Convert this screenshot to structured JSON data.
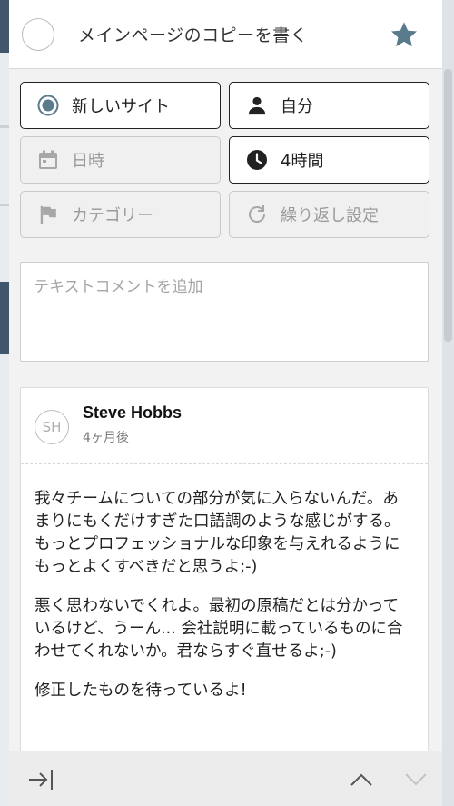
{
  "task": {
    "title": "メインページのコピーを書く",
    "starred": true
  },
  "options": {
    "site": "新しいサイト",
    "assignee": "自分",
    "datetime": "日時",
    "duration": "4時間",
    "category": "カテゴリー",
    "repeat": "繰り返し設定"
  },
  "comment_input": {
    "placeholder": "テキストコメントを追加"
  },
  "comment": {
    "avatar_initials": "SH",
    "author": "Steve Hobbs",
    "time": "4ヶ月後",
    "paragraphs": [
      "我々チームについての部分が気に入らないんだ。あまりにもくだけすぎた口語調のような感じがする。もっとプロフェッショナルな印象を与えれるようにもっとよくすべきだと思うよ;-)",
      "悪く思わないでくれよ。最初の原稿だとは分かっているけど、うーん... 会社説明に載っているものに合わせてくれないか。君ならすぐ直せるよ;-)",
      "修正したものを待っているよ!"
    ]
  },
  "colors": {
    "accent": "#5a7b8c",
    "border_active": "#222222",
    "border_disabled": "#c9c9c9"
  },
  "icons": {
    "star": "star-icon",
    "radio": "radio-selected-icon",
    "person": "person-icon",
    "calendar": "calendar-icon",
    "clock": "clock-icon",
    "flag": "flag-icon",
    "repeat": "repeat-icon",
    "collapse": "collapse-panel-icon",
    "up": "chevron-up-icon",
    "down": "chevron-down-icon"
  }
}
